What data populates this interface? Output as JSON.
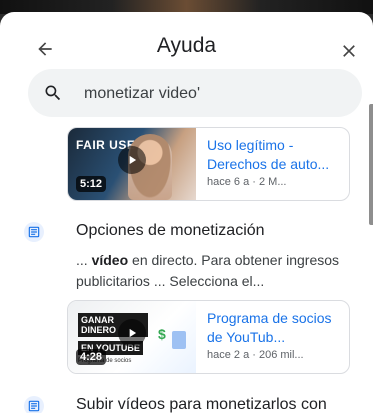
{
  "header": {
    "title": "Ayuda",
    "back_icon": "arrow-back-icon",
    "close_icon": "close-icon"
  },
  "search": {
    "icon": "search-icon",
    "value": "monetizar video'"
  },
  "videos": [
    {
      "thumb_text": "FAIR USE",
      "duration": "5:12",
      "title": "Uso legítimo - Derechos de auto...",
      "meta": "hace 6 a · 2 M..."
    },
    {
      "thumb_lines": [
        "GANAR DINERO",
        "EN YOUTUBE",
        "Programa de socios"
      ],
      "duration": "4:28",
      "title": "Programa de socios de YouTub...",
      "meta": "hace 2 a · 206 mil..."
    }
  ],
  "results": [
    {
      "icon": "document-icon",
      "title": "Opciones de monetización",
      "snippet_pre": "... ",
      "snippet_bold": "vídeo",
      "snippet_post": " en directo. Para obtener ingresos publicitarios ... Selecciona el..."
    },
    {
      "icon": "document-icon",
      "title": "Subir vídeos para monetizarlos con"
    }
  ],
  "colors": {
    "link": "#1a73e8",
    "search_bg": "#f1f3f4",
    "icon_blue": "#1a73e8"
  }
}
